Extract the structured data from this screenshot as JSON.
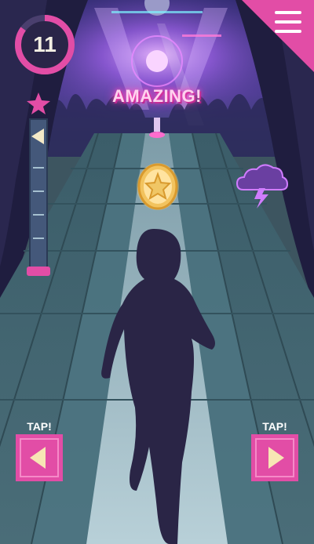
{
  "hud": {
    "timer_value": "11",
    "timer_fraction_remaining": 0.85,
    "menu_icon": "hamburger-menu-icon",
    "progress_fraction": 0.05
  },
  "feedback": {
    "text": "AMAZING!"
  },
  "controls": {
    "left_tap_label": "TAP!",
    "right_tap_label": "TAP!",
    "left_icon": "arrow-left-icon",
    "right_icon": "arrow-right-icon"
  },
  "pickups": {
    "coin_icon": "star-coin-icon",
    "hazard_icon": "storm-cloud-icon"
  },
  "colors": {
    "accent": "#e24da6",
    "road": "#a8c3cc",
    "lane_side": "#5b7f8b",
    "silhouette": "#2a2546",
    "stage_glow": "#b46cff"
  }
}
